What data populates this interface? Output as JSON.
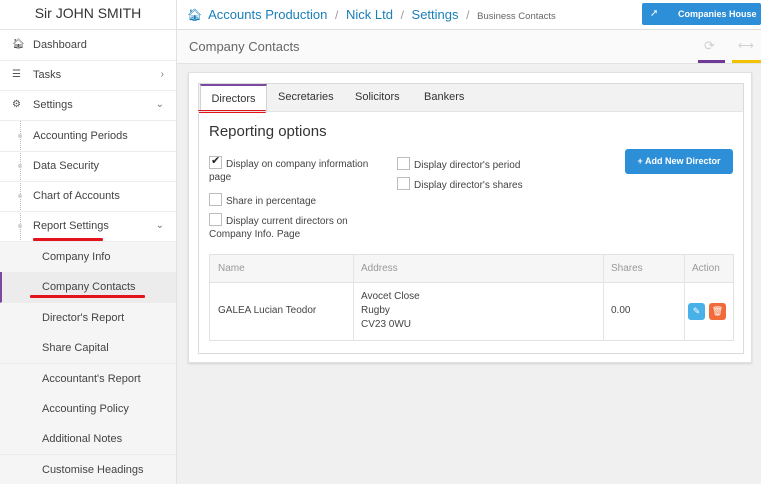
{
  "sidebar": {
    "user_name": "Sir JOHN SMITH",
    "items": [
      {
        "label": "Dashboard",
        "icon": "home-icon"
      },
      {
        "label": "Tasks",
        "icon": "list-icon"
      },
      {
        "label": "Settings",
        "icon": "gear-icon"
      }
    ],
    "settings_sub": [
      "Accounting Periods",
      "Data Security",
      "Chart of Accounts",
      "Report Settings"
    ],
    "report_sub": [
      "Company Info",
      "Company Contacts",
      "Director's Report",
      "Share Capital",
      "Accountant's Report",
      "Accounting Policy",
      "Additional Notes",
      "Customise Headings"
    ]
  },
  "topbar": {
    "crumbs": [
      "Accounts Production",
      "Nick Ltd",
      "Settings",
      "Business Contacts"
    ],
    "companies_house_label": "Companies House"
  },
  "page": {
    "title": "Company Contacts"
  },
  "tabs": [
    "Directors",
    "Secretaries",
    "Solicitors",
    "Bankers"
  ],
  "reporting": {
    "title": "Reporting options",
    "options": [
      {
        "label": "Display on company information page",
        "checked": true
      },
      {
        "label": "Share in percentage",
        "checked": false
      },
      {
        "label": "Display current directors on Company Info. Page",
        "checked": false
      },
      {
        "label": "Display director's period",
        "checked": false
      },
      {
        "label": "Display director's shares",
        "checked": false
      }
    ],
    "add_button": "+ Add New Director"
  },
  "table": {
    "headers": [
      "Name",
      "Address",
      "Shares",
      "Action"
    ],
    "rows": [
      {
        "name": "GALEA Lucian Teodor",
        "address": [
          "Avocet Close",
          "Rugby",
          "CV23 0WU"
        ],
        "shares": "0.00"
      }
    ]
  },
  "colors": {
    "accent_purple": "#7b4a9e",
    "brand_blue": "#2d8fd8",
    "underline_red": "#e3121b",
    "edit_blue": "#48b2e8",
    "delete_orange": "#f26b3a",
    "accent_yellow": "#f2c200"
  }
}
